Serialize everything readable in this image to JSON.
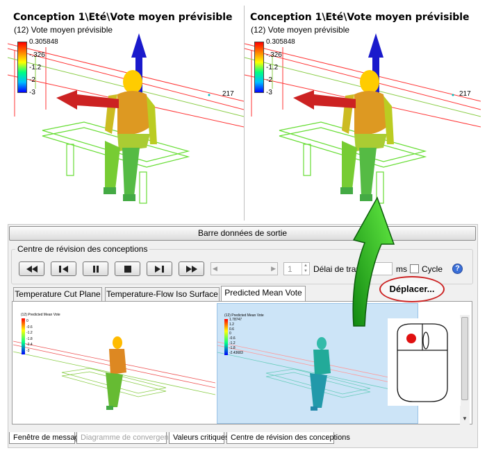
{
  "viewports": [
    {
      "title": "Conception 1\\Eté\\Vote moyen prévisible",
      "subtitle": "(12) Vote moyen prévisible",
      "legend_ticks": [
        "0.305848",
        "-.326",
        "-1.2",
        "-2",
        "-3"
      ],
      "probe_value": "217"
    },
    {
      "title": "Conception 1\\Eté\\Vote moyen prévisible",
      "subtitle": "(12) Vote moyen prévisible",
      "legend_ticks": [
        "0.305848",
        "-.326",
        "-1.2",
        "-2",
        "-3"
      ],
      "probe_value": "217"
    }
  ],
  "output_bar": {
    "label": "Barre données de sortie"
  },
  "review_center": {
    "label": "Centre de révision des conceptions",
    "buttons": [
      "rewind-icon",
      "step-back-icon",
      "pause-icon",
      "stop-icon",
      "step-forward-icon",
      "fast-forward-icon"
    ],
    "frame_value": "1",
    "delay_label": "Délai de trame:",
    "delay_unit": "ms",
    "cycle_label": "Cycle",
    "help_icon": "help-icon"
  },
  "tabs": [
    {
      "label": "Temperature Cut Plane",
      "active": false
    },
    {
      "label": "Temperature-Flow Iso Surface",
      "active": false
    },
    {
      "label": "Predicted Mean Vote",
      "active": true
    }
  ],
  "thumbnails": [
    {
      "title": "(12) Predicted Mean Vote",
      "ticks": [
        "0",
        "-0.6",
        "-1.2",
        "-1.8",
        "-2.4",
        "-3"
      ]
    },
    {
      "title": "(12) Predicted Mean Vote",
      "ticks": [
        "1.78747",
        "1.2",
        "0.6",
        "0",
        "-0.6",
        "-1.2",
        "-1.8",
        "-2.43683"
      ]
    }
  ],
  "callout": {
    "label": "Déplacer..."
  },
  "bottom_tabs": [
    {
      "label": "Fenêtre de message",
      "disabled": false
    },
    {
      "label": "Diagramme de convergence",
      "disabled": true
    },
    {
      "label": "Valeurs critiques",
      "disabled": false
    },
    {
      "label": "Centre de révision des conceptions",
      "disabled": false
    }
  ],
  "colors": {
    "accent": "#cc2222",
    "arrow_green": "#22aa22",
    "selected_thumb": "#cce4f7"
  }
}
